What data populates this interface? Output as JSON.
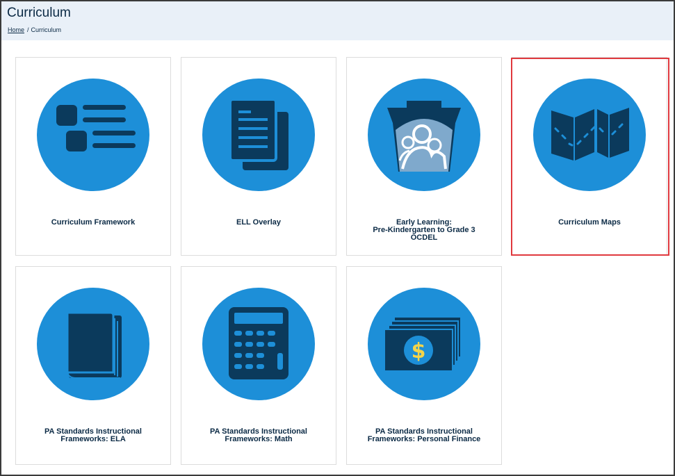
{
  "header": {
    "title": "Curriculum",
    "breadcrumb": {
      "home": "Home",
      "separator": "/",
      "current": "Curriculum"
    }
  },
  "tiles": [
    {
      "label_lines": [
        "Curriculum Framework"
      ],
      "icon": "list-icon"
    },
    {
      "label_lines": [
        "ELL Overlay"
      ],
      "icon": "documents-icon"
    },
    {
      "label_lines": [
        "Early Learning:",
        "Pre-Kindergarten to Grade 3",
        "OCDEL"
      ],
      "icon": "family-keystone-icon"
    },
    {
      "label_lines": [
        "Curriculum Maps"
      ],
      "icon": "folded-map-icon"
    },
    {
      "label_lines": [
        "PA Standards Instructional",
        "Frameworks: ELA"
      ],
      "icon": "book-icon"
    },
    {
      "label_lines": [
        "PA Standards Instructional",
        "Frameworks: Math"
      ],
      "icon": "calculator-icon"
    },
    {
      "label_lines": [
        "PA Standards Instructional",
        "Frameworks: Personal Finance"
      ],
      "icon": "money-stack-icon"
    }
  ],
  "colors": {
    "accent_blue": "#1d8fd8",
    "icon_navy": "#0b3a5c",
    "highlight_red": "#e0393e",
    "header_bg": "#e9f0f8",
    "dollar_yellow": "#f3d44a"
  }
}
